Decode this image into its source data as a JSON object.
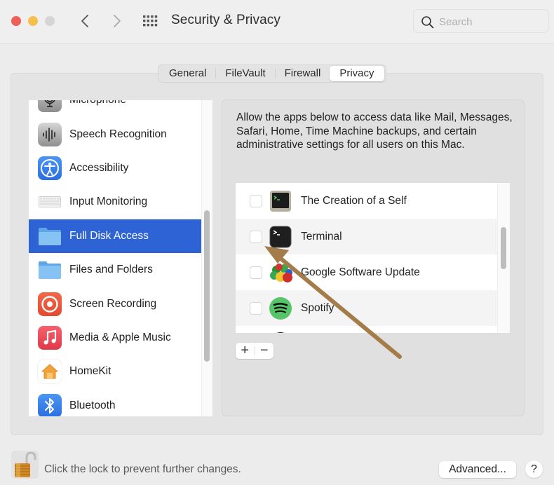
{
  "window": {
    "title": "Security & Privacy",
    "search_placeholder": "Search"
  },
  "tabs": [
    {
      "label": "General",
      "active": false
    },
    {
      "label": "FileVault",
      "active": false
    },
    {
      "label": "Firewall",
      "active": false
    },
    {
      "label": "Privacy",
      "active": true
    }
  ],
  "sidebar": {
    "items": [
      {
        "label": "Microphone",
        "icon": "microphone-icon"
      },
      {
        "label": "Speech Recognition",
        "icon": "speech-recognition-icon"
      },
      {
        "label": "Accessibility",
        "icon": "accessibility-icon"
      },
      {
        "label": "Input Monitoring",
        "icon": "keyboard-icon"
      },
      {
        "label": "Full Disk Access",
        "icon": "folder-icon",
        "selected": true
      },
      {
        "label": "Files and Folders",
        "icon": "folder-icon"
      },
      {
        "label": "Screen Recording",
        "icon": "screen-recording-icon"
      },
      {
        "label": "Media & Apple Music",
        "icon": "music-icon"
      },
      {
        "label": "HomeKit",
        "icon": "home-icon"
      },
      {
        "label": "Bluetooth",
        "icon": "bluetooth-icon"
      }
    ]
  },
  "panel": {
    "description": "Allow the apps below to access data like Mail, Messages, Safari, Home, Time Machine backups, and certain administrative settings for all users on this Mac.",
    "apps": [
      {
        "name": "The Creation of a Self",
        "checked": false,
        "icon": "terminal-app-icon"
      },
      {
        "name": "Terminal",
        "checked": false,
        "icon": "terminal-icon"
      },
      {
        "name": "Google Software Update",
        "checked": false,
        "icon": "google-software-update-icon"
      },
      {
        "name": "Spotify",
        "checked": false,
        "icon": "spotify-icon"
      }
    ],
    "add_label": "+",
    "remove_label": "−"
  },
  "footer": {
    "lock_text": "Click the lock to prevent further changes.",
    "advanced_label": "Advanced...",
    "help_label": "?"
  },
  "colors": {
    "selection": "#2e63d6",
    "annotation_arrow": "#a47c4a"
  }
}
